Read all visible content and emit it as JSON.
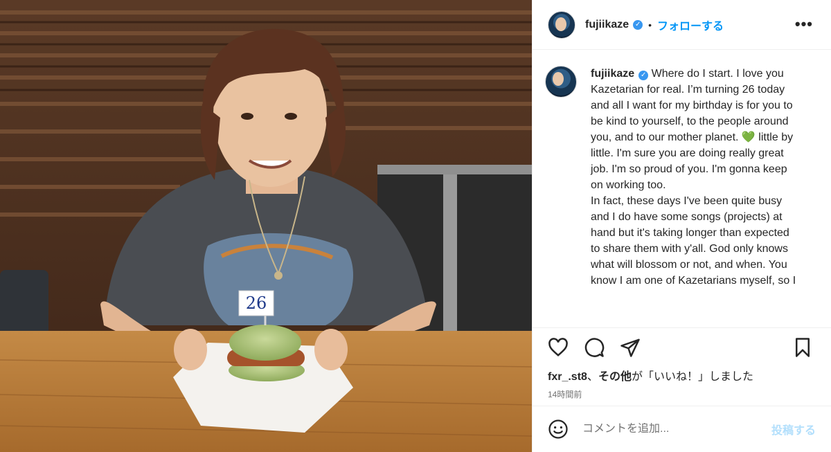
{
  "header": {
    "username": "fujiikaze",
    "separator": "•",
    "follow_label": "フォローする",
    "more_label": "•••"
  },
  "photo": {
    "flag_number": "26"
  },
  "caption": {
    "username": "fujiikaze",
    "text_before_emoji": "Where do I start. I love you Kazetarian for real. I’m turning 26 today and all I want for my birthday is for you to be kind to yourself, to the people around you, and to our mother planet. ",
    "emoji": "💚",
    "text_after_emoji": " little by little. I'm sure you are doing really great job. I'm so proud of you. I'm gonna keep on working too.\nIn fact, these days I've been quite busy and I do have some songs (projects) at hand but it's taking longer than expected to share them with y'all. God only knows what will blossom or not, and when. You know I am one of Kazetarians myself, so I"
  },
  "actions": {
    "like_icon": "heart-icon",
    "comment_icon": "comment-icon",
    "share_icon": "send-icon",
    "save_icon": "bookmark-icon"
  },
  "likes": {
    "user": "fxr_.st8",
    "sep": "、",
    "others": "その他",
    "suffix": "が「いいね！」しました"
  },
  "timestamp": "14時間前",
  "comment": {
    "placeholder": "コメントを追加...",
    "post_label": "投稿する"
  },
  "colors": {
    "accent": "#0095f6",
    "post_disabled": "#b2dffc",
    "verified": "#3897f0"
  }
}
